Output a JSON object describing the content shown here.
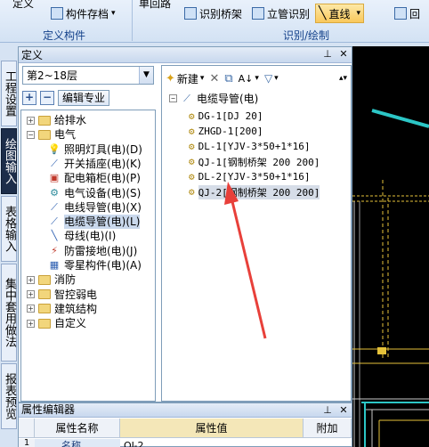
{
  "ribbon": {
    "define_label": "定义",
    "component_save": "构件存档",
    "group_define": "定义构件",
    "single_loop": "单回路",
    "identify_bridge": "识别桥架",
    "identify_riser": "立管识别",
    "straight_line": "直线",
    "back": "回",
    "group_identify": "识别/绘制"
  },
  "vtabs": [
    "工程设置",
    "绘图输入",
    "表格输入",
    "集中套用做法",
    "报表预览"
  ],
  "panel": {
    "title": "定义",
    "floor": "第2~18层",
    "edit_major": "编辑专业"
  },
  "tree": [
    {
      "label": "给排水",
      "level": 0,
      "type": "folder",
      "state": "+"
    },
    {
      "label": "电气",
      "level": 0,
      "type": "folder",
      "state": "-"
    },
    {
      "label": "照明灯具(电)(D)",
      "level": 1,
      "type": "bulb"
    },
    {
      "label": "开关插座(电)(K)",
      "level": 1,
      "type": "switch"
    },
    {
      "label": "配电箱柜(电)(P)",
      "level": 1,
      "type": "box"
    },
    {
      "label": "电气设备(电)(S)",
      "level": 1,
      "type": "device"
    },
    {
      "label": "电线导管(电)(X)",
      "level": 1,
      "type": "wire"
    },
    {
      "label": "电缆导管(电)(L)",
      "level": 1,
      "type": "cable",
      "selected": true
    },
    {
      "label": "母线(电)(I)",
      "level": 1,
      "type": "bus"
    },
    {
      "label": "防雷接地(电)(J)",
      "level": 1,
      "type": "lightning"
    },
    {
      "label": "零星构件(电)(A)",
      "level": 1,
      "type": "misc"
    },
    {
      "label": "消防",
      "level": 0,
      "type": "folder",
      "state": "+"
    },
    {
      "label": "智控弱电",
      "level": 0,
      "type": "folder",
      "state": "+"
    },
    {
      "label": "建筑结构",
      "level": 0,
      "type": "folder",
      "state": "+"
    },
    {
      "label": "自定义",
      "level": 0,
      "type": "folder",
      "state": "+"
    }
  ],
  "right_toolbar": {
    "new_label": "新建"
  },
  "right_tree": {
    "root": "电缆导管(电)",
    "items": [
      "DG-1[DJ 20]",
      "ZHGD-1[200]",
      "DL-1[YJV-3*50+1*16]",
      "QJ-1[钢制桥架 200 200]",
      "DL-2[YJV-3*50+1*16]",
      "QJ-2[钢制桥架 200 200]"
    ]
  },
  "prop_editor": {
    "title": "属性编辑器",
    "col_name": "属性名称",
    "col_value": "属性值",
    "col_extra": "附加",
    "row1_name": "名称",
    "row1_value": "QJ-2"
  },
  "colors": {
    "accent_arrow": "#e8403a",
    "cad_cyan": "#2cc6c6",
    "cad_yellow": "#e6c23a"
  }
}
